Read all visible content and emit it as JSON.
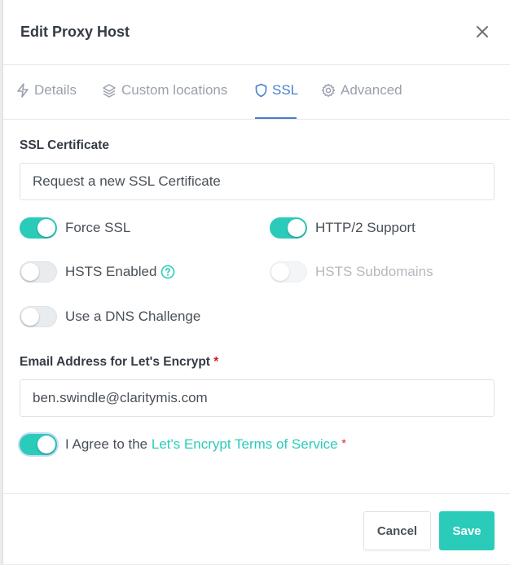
{
  "modal": {
    "title": "Edit Proxy Host"
  },
  "tabs": [
    {
      "label": "Details",
      "icon": "lightning-icon",
      "active": false
    },
    {
      "label": "Custom locations",
      "icon": "layers-icon",
      "active": false
    },
    {
      "label": "SSL",
      "icon": "shield-icon",
      "active": true
    },
    {
      "label": "Advanced",
      "icon": "gear-icon",
      "active": false
    }
  ],
  "ssl": {
    "certificate_label": "SSL Certificate",
    "certificate_value": "Request a new SSL Certificate",
    "toggles": {
      "force_ssl": {
        "label": "Force SSL",
        "on": true
      },
      "http2": {
        "label": "HTTP/2 Support",
        "on": true
      },
      "hsts": {
        "label": "HSTS Enabled",
        "on": false
      },
      "hsts_subdomains": {
        "label": "HSTS Subdomains",
        "on": false,
        "disabled": true
      },
      "dns_challenge": {
        "label": "Use a DNS Challenge",
        "on": false
      }
    },
    "email_label": "Email Address for Let's Encrypt",
    "required_mark": "*",
    "email_value": "ben.swindle@claritymis.com",
    "agree_prefix": "I Agree to the ",
    "agree_link": "Let's Encrypt Terms of Service",
    "agree_on": true
  },
  "footer": {
    "cancel_label": "Cancel",
    "save_label": "Save"
  },
  "colors": {
    "accent": "#2bcbba",
    "tab_active": "#467fcf",
    "required": "#cd201f"
  }
}
